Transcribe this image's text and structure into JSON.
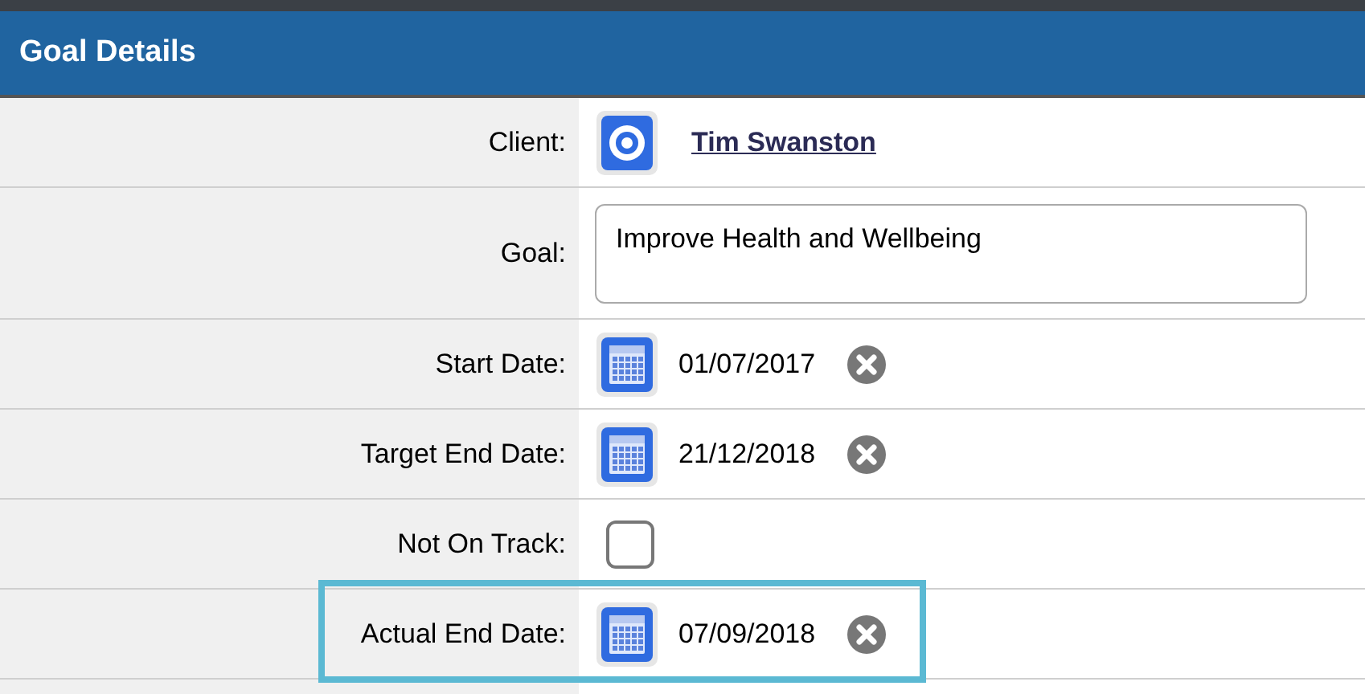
{
  "panel": {
    "title": "Goal Details"
  },
  "fields": [
    {
      "kind": "client",
      "label": "Client:",
      "value": "Tim Swanston",
      "highlighted": false
    },
    {
      "kind": "textarea",
      "label": "Goal:",
      "value": "Improve Health and Wellbeing",
      "highlighted": false
    },
    {
      "kind": "date",
      "label": "Start Date:",
      "value": "01/07/2017",
      "highlighted": false
    },
    {
      "kind": "date",
      "label": "Target End Date:",
      "value": "21/12/2018",
      "highlighted": false
    },
    {
      "kind": "checkbox",
      "label": "Not On Track:",
      "checked": false,
      "highlighted": false
    },
    {
      "kind": "date",
      "label": "Actual End Date:",
      "value": "07/09/2018",
      "highlighted": true
    }
  ]
}
